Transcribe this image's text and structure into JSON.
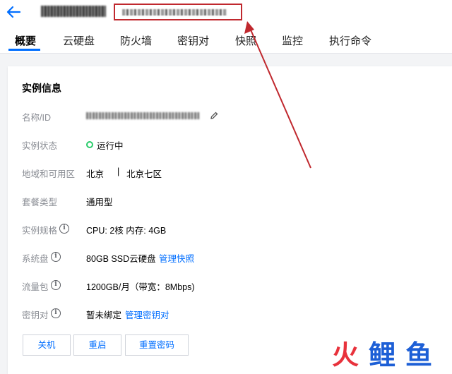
{
  "header": {
    "back_icon": "arrow-left-icon",
    "instance_name": "",
    "instance_ip": ""
  },
  "tabs": [
    {
      "label": "概要",
      "active": true
    },
    {
      "label": "云硬盘",
      "active": false
    },
    {
      "label": "防火墙",
      "active": false
    },
    {
      "label": "密钥对",
      "active": false
    },
    {
      "label": "快照",
      "active": false
    },
    {
      "label": "监控",
      "active": false
    },
    {
      "label": "执行命令",
      "active": false
    }
  ],
  "instance_info": {
    "title": "实例信息",
    "name_id_label": "名称/ID",
    "status_label": "实例状态",
    "status_value": "运行中",
    "region_label": "地域和可用区",
    "region_value": "北京",
    "region_separator": "|",
    "zone_value": "北京七区",
    "package_label": "套餐类型",
    "package_value": "通用型",
    "spec_label": "实例规格",
    "spec_value": "CPU: 2核 内存: 4GB",
    "system_disk_label": "系统盘",
    "system_disk_value": "80GB SSD云硬盘",
    "system_disk_link": "管理快照",
    "traffic_label": "流量包",
    "traffic_value": "1200GB/月（带宽：8Mbps)",
    "keypair_label": "密钥对",
    "keypair_value": "暂未绑定",
    "keypair_link": "管理密钥对"
  },
  "actions": {
    "shutdown": "关机",
    "restart": "重启",
    "reset_password": "重置密码"
  },
  "watermark": {
    "chars": [
      "火",
      "鲤",
      "鱼"
    ]
  },
  "colors": {
    "accent": "#006eff",
    "status_running": "#29cc6a",
    "annotation": "#c0282e",
    "watermark_red": "#e8323c",
    "watermark_blue": "#1d5fd6"
  }
}
